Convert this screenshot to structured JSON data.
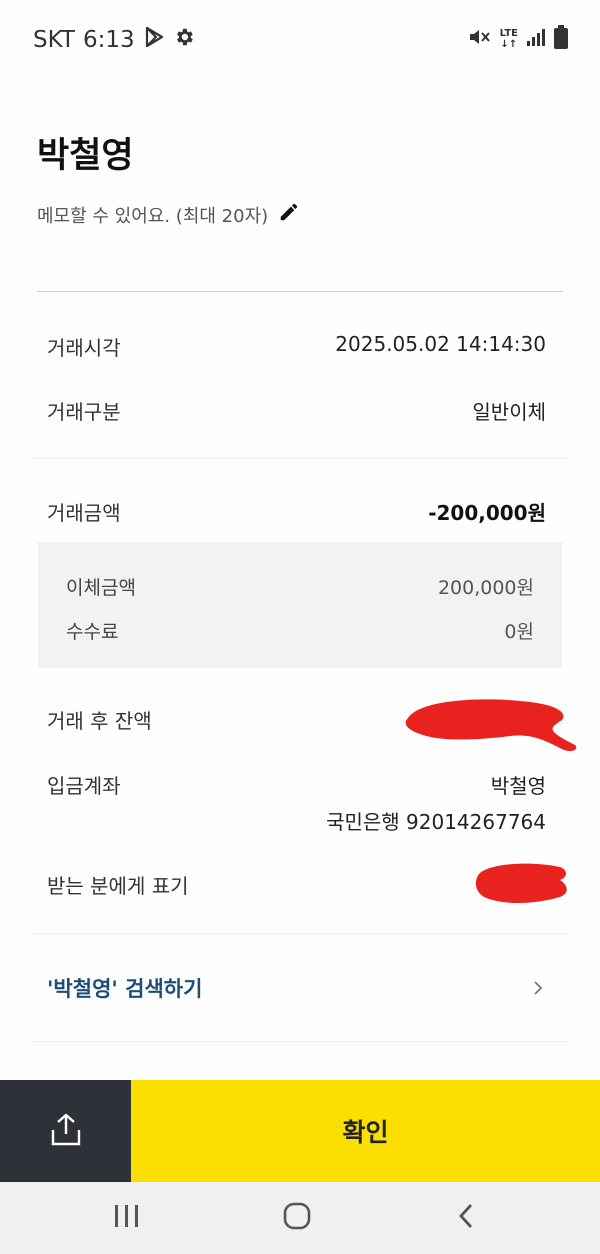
{
  "status_bar": {
    "carrier": "SKT",
    "time": "6:13",
    "lte": "LTE",
    "icons": [
      "play-store-icon",
      "gear-icon",
      "mute-icon",
      "lte-data-icon",
      "signal-icon",
      "battery-icon"
    ]
  },
  "header": {
    "name": "박철영",
    "memo_placeholder": "메모할 수 있어요. (최대 20자)"
  },
  "details": {
    "time_label": "거래시각",
    "time_value": "2025.05.02 14:14:30",
    "type_label": "거래구분",
    "type_value": "일반이체",
    "amount_label": "거래금액",
    "amount_value": "-200,000원",
    "transfer_label": "이체금액",
    "transfer_value": "200,000원",
    "fee_label": "수수료",
    "fee_value": "0원",
    "balance_label": "거래 후 잔액",
    "deposit_label": "입금계좌",
    "deposit_name": "박철영",
    "deposit_account": "국민은행 92014267764",
    "display_label": "받는 분에게 표기"
  },
  "search": {
    "label": "'박철영' 검색하기"
  },
  "bottom": {
    "confirm_label": "확인"
  },
  "colors": {
    "confirm_bg": "#fbdf00",
    "share_bg": "#2e3138",
    "link": "#1f4d78",
    "redaction": "#e8231f"
  }
}
